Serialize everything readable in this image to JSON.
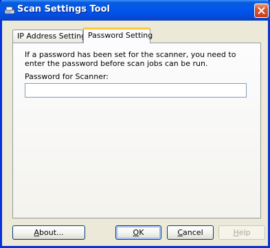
{
  "window": {
    "title": "Scan Settings Tool"
  },
  "tabs": [
    {
      "label": "IP Address Settings",
      "active": false
    },
    {
      "label": "Password Setting",
      "active": true
    }
  ],
  "panel": {
    "description": "If a password has been set for the scanner, you need to enter the password before scan jobs can be run.",
    "password_label": "Password for Scanner:",
    "password_value": ""
  },
  "buttons": {
    "about": {
      "label": "About...",
      "mnemonic": "A"
    },
    "ok": {
      "label": "OK",
      "mnemonic": "O"
    },
    "cancel": {
      "label": "Cancel",
      "mnemonic": "C"
    },
    "help": {
      "label": "Help",
      "mnemonic": "H",
      "enabled": false
    }
  },
  "icons": {
    "app": "scanner-icon",
    "close": "close-icon"
  },
  "colors": {
    "titlebar": "#0058ee",
    "close_button": "#d7542c",
    "active_tab_accent": "#ffc83c",
    "dialog_background": "#ece9d8"
  }
}
